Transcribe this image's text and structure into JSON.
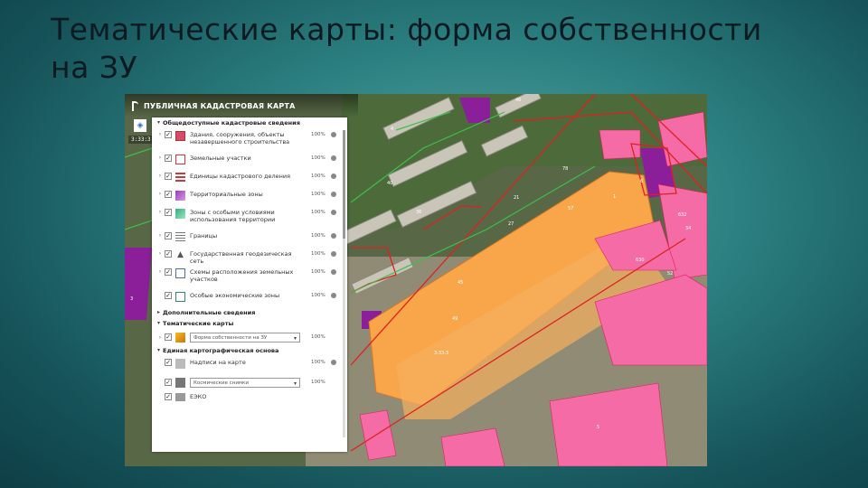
{
  "slide": {
    "title_line1": "Тематические карты: форма собственности",
    "title_line2": "на ЗУ"
  },
  "app": {
    "name": "ПУБЛИЧНАЯ КАДАСТРОВАЯ КАРТА",
    "rail_badge": "3:33:3"
  },
  "panel": {
    "section_general": "Общедоступные кадастровые сведения",
    "layers": [
      {
        "label": "Здания, сооружения, объекты незавершенного строительства",
        "opacity": "100%",
        "swatch": "#d94a6a",
        "icon": "building-icon"
      },
      {
        "label": "Земельные участки",
        "opacity": "100%",
        "swatch": "#ffffff",
        "icon": "parcel-icon"
      },
      {
        "label": "Единицы кадастрового деления",
        "opacity": "100%",
        "swatch": "#c43b3b",
        "icon": "division-icon"
      },
      {
        "label": "Территориальные зоны",
        "opacity": "100%",
        "swatch": "#9a3db8",
        "icon": "territory-zone-icon"
      },
      {
        "label": "Зоны с особыми условиями использования территории",
        "opacity": "100%",
        "swatch": "#2fb07a",
        "icon": "special-zone-icon"
      },
      {
        "label": "Границы",
        "opacity": "100%",
        "swatch": "#777777",
        "icon": "boundary-icon"
      },
      {
        "label": "Государственная геодезическая сеть",
        "opacity": "100%",
        "swatch": "#555555",
        "icon": "geodesy-icon"
      },
      {
        "label": "Схемы расположения земельных участков",
        "opacity": "100%",
        "swatch": "#ffffff",
        "icon": "scheme-icon"
      },
      {
        "label": "Особые экономические зоны",
        "opacity": "100%",
        "swatch": "#ffffff",
        "icon": "economic-zone-icon"
      }
    ],
    "section_additional": "Дополнительные сведения",
    "section_thematic": "Тематические карты",
    "thematic_select": "Форма собственности на ЗУ",
    "thematic_opacity": "100%",
    "section_base": "Единая картографическая основа",
    "base_layers": [
      {
        "label": "Надписи на карте",
        "opacity": "100%"
      },
      {
        "label": "Космические снимки",
        "opacity": "100%"
      }
    ],
    "base_partial": "ЕЭКО"
  },
  "map": {
    "parcel_labels": [
      "4",
      "78",
      "21",
      "57",
      "1",
      "6",
      "34",
      "630",
      "632",
      "52",
      "49",
      "5",
      "46",
      "45",
      "36",
      "27",
      "40",
      "3",
      "3:33:3"
    ]
  },
  "colors": {
    "orange_parcel": "#f8a649",
    "pink_parcel": "#f46ba5",
    "purple_zone": "#8b1f9a",
    "red_boundary": "#e02020",
    "green_boundary": "#3dbf4b"
  }
}
